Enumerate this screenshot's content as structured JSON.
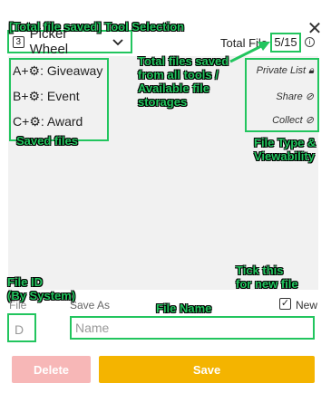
{
  "header": {
    "tool_badge": "3",
    "tool_name": "Picker Wheel",
    "chevron_icon": "chevron-down-icon",
    "total_label": "Total File",
    "total_count": "5/15",
    "info_icon": "ⓘ",
    "close_icon": "✕"
  },
  "files": [
    {
      "prefix": "A",
      "name": "Giveaway"
    },
    {
      "prefix": "B",
      "name": "Event"
    },
    {
      "prefix": "C",
      "name": "Award"
    }
  ],
  "file_types": [
    {
      "label": "Private List",
      "icon": "lock-icon"
    },
    {
      "label": "Share",
      "icon": "no-entry-icon"
    },
    {
      "label": "Collect",
      "icon": "no-entry-icon"
    }
  ],
  "form": {
    "file_label": "File",
    "save_as_label": "Save As",
    "file_id": "D",
    "name_placeholder": "Name",
    "name_value": "",
    "new_label": "New",
    "new_checked": true,
    "delete_label": "Delete",
    "save_label": "Save"
  },
  "annotations": {
    "tool_selection": "[Total file saved] Tool Selection",
    "total_files": [
      "Total files saved",
      "from all tools  /",
      "Available file",
      "storages"
    ],
    "saved_files": "Saved files",
    "file_type": [
      "File Type &",
      "Viewability"
    ],
    "file_id": [
      "File ID",
      "(By System)"
    ],
    "tick_new": [
      "Tick this",
      "for new file"
    ],
    "file_name": "File Name"
  },
  "colors": {
    "annotation_green": "#22c55e",
    "delete_button": "#f7b7b7",
    "save_button": "#f4b400"
  }
}
